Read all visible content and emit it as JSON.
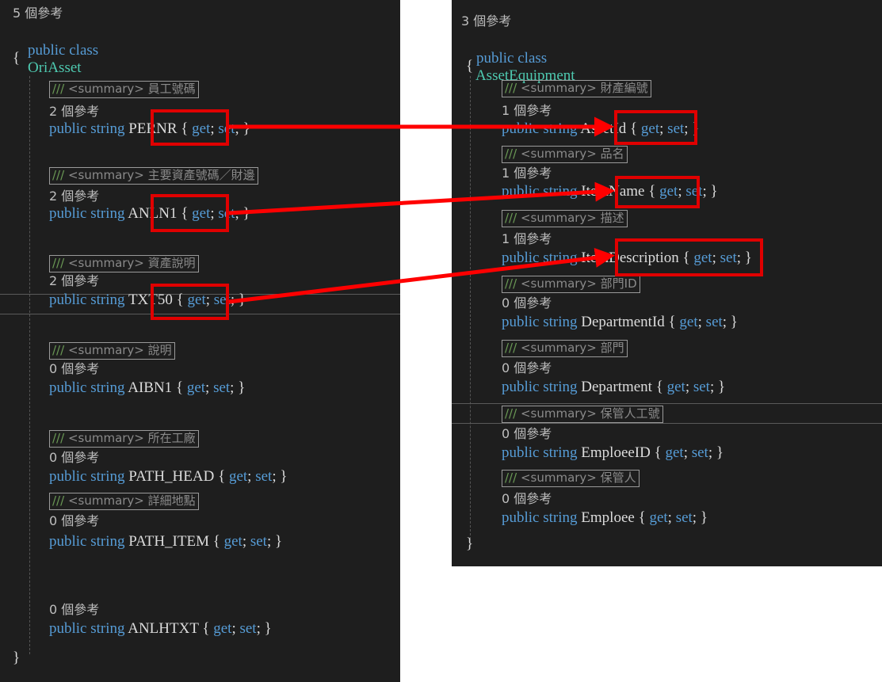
{
  "left": {
    "refs_header": "5 個參考",
    "class_decl": {
      "kw": "public class",
      "name": "OriAsset"
    },
    "open_brace": "{",
    "close_brace": "}",
    "props": [
      {
        "summary": "員工號碼",
        "refs": "2 個參考",
        "name": "PERNR"
      },
      {
        "summary": "主要資產號碼／財邊",
        "refs": "2 個參考",
        "name": "ANLN1"
      },
      {
        "summary": "資產說明",
        "refs": "2 個參考",
        "name": "TXT50"
      },
      {
        "summary": "說明",
        "refs": "0 個參考",
        "name": "AIBN1"
      },
      {
        "summary": "所在工廠",
        "refs": "0 個參考",
        "name": "PATH_HEAD"
      },
      {
        "summary": "詳細地點",
        "refs": "0 個參考",
        "name": "PATH_ITEM"
      },
      {
        "summary": "",
        "refs": "0 個參考",
        "name": "ANLHTXT"
      }
    ]
  },
  "right": {
    "refs_header": "3 個參考",
    "class_decl": {
      "kw": "public class",
      "name": "AssetEquipment"
    },
    "open_brace": "{",
    "close_brace": "}",
    "props": [
      {
        "summary": "財產編號",
        "refs": "1 個參考",
        "name": "AssetId"
      },
      {
        "summary": "品名",
        "refs": "1 個參考",
        "name": "ItemName"
      },
      {
        "summary": "描述",
        "refs": "1 個參考",
        "name": "ItemDescription"
      },
      {
        "summary": "部門ID",
        "refs": "0 個參考",
        "name": "DepartmentId"
      },
      {
        "summary": "部門",
        "refs": "0 個參考",
        "name": "Department"
      },
      {
        "summary": "保管人工號",
        "refs": "0 個參考",
        "name": "EmploeeID"
      },
      {
        "summary": "保管人",
        "refs": "0 個參考",
        "name": "Emploee"
      }
    ]
  },
  "code": {
    "public_string": "public string",
    "getset_open": "{ ",
    "get": "get",
    "semi_space": "; ",
    "set": "set",
    "getset_close": "; }",
    "comment_prefix": "///",
    "summary_tag": "<summary>"
  },
  "colors": {
    "editor_bg": "#1e1e1e",
    "keyword": "#569cd6",
    "class_name": "#4ec9b0",
    "identifier": "#dcdcdc",
    "highlight": "#e00000",
    "arrow": "#ff0000"
  }
}
